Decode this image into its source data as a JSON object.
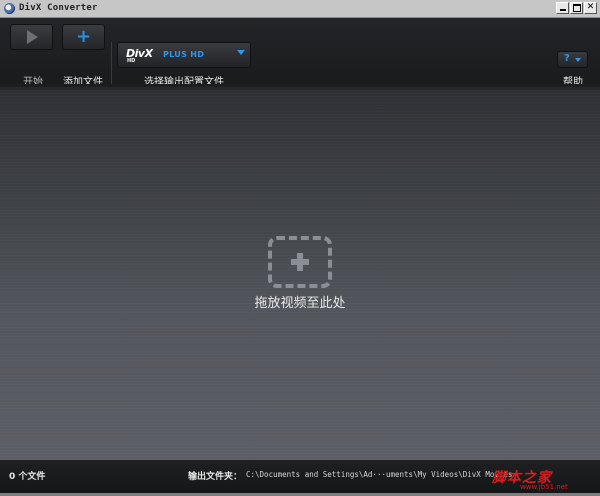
{
  "window": {
    "title": "DivX Converter"
  },
  "toolbar": {
    "start_label": "开始",
    "add_files_label": "添加文件",
    "profile_label": "选择输出配置文件",
    "help_label": "帮助",
    "profile": {
      "logo": "DivX",
      "logo_sub": "HD",
      "value": "PLUS HD"
    },
    "help_glyph": "?"
  },
  "dropzone": {
    "text": "拖放视频至此处"
  },
  "status": {
    "file_count": "0 个文件",
    "output_folder_label": "输出文件夹：",
    "output_folder_path": "C:\\Documents and Settings\\Ad···uments\\My Videos\\DivX Movies"
  },
  "watermark": {
    "text": "脚本之家",
    "url": "www.jb51.net"
  },
  "colors": {
    "accent": "#2c98ea",
    "background": "#1b1c1e",
    "titlebar": "#c6c6c6"
  },
  "icons": [
    "divx-app-icon",
    "minimize-icon",
    "maximize-icon",
    "close-icon",
    "play-icon",
    "add-icon",
    "dropdown-arrow-icon",
    "help-icon",
    "drop-add-icon"
  ]
}
